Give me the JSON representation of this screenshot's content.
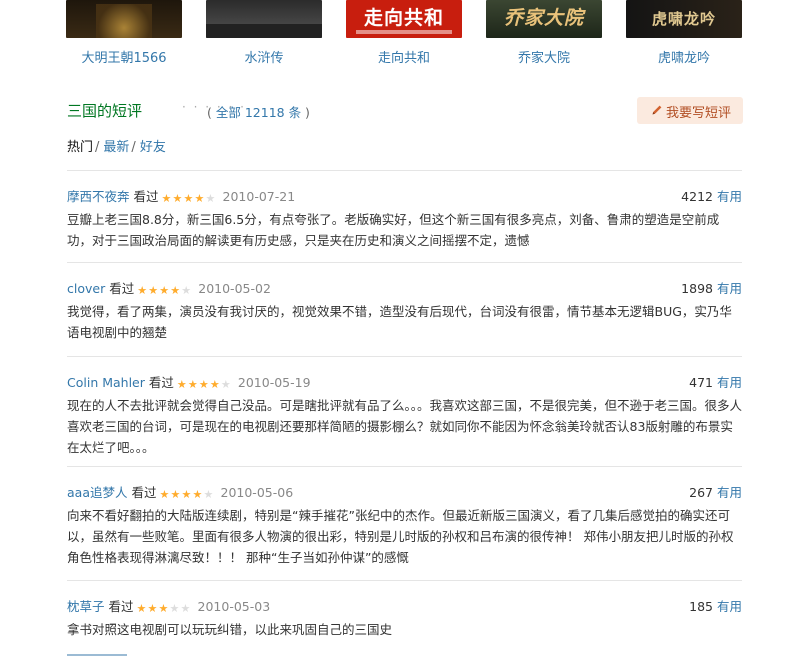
{
  "related_shows": [
    {
      "title": "大明王朝1566",
      "poster_text": "",
      "bg": "#2a2014",
      "fg": "#d9a84a"
    },
    {
      "title": "水浒传",
      "poster_text": "",
      "bg": "#3a3a3a",
      "fg": "#cccccc"
    },
    {
      "title": "走向共和",
      "poster_text": "走向共和",
      "bg": "#c81e0e",
      "fg": "#ffffff"
    },
    {
      "title": "乔家大院",
      "poster_text": "乔家大院",
      "bg": "#2c3a2a",
      "fg": "#e9c27a"
    },
    {
      "title": "虎啸龙吟",
      "poster_text": "虎啸龙吟",
      "bg": "#1a1a1a",
      "fg": "#e0c890"
    }
  ],
  "section": {
    "title": "三国的短评",
    "dots": "· · · · · ·",
    "count_open": "( ",
    "count_text": "全部 12118 条",
    "count_close": " )",
    "write_button": "我要写短评"
  },
  "tabs": {
    "hot": "热门",
    "sep": "/",
    "latest": "最新",
    "friends": "好友"
  },
  "comments": [
    {
      "user": "摩西不夜奔",
      "status": "看过",
      "rating": 4,
      "date": "2010-07-21",
      "votes": "4212",
      "useful": "有用",
      "text": "豆瓣上老三国8.8分，新三国6.5分，有点夸张了。老版确实好，但这个新三国有很多亮点，刘备、鲁肃的塑造是空前成功，对于三国政治局面的解读更有历史感，只是夹在历史和演义之间摇摆不定，遗憾"
    },
    {
      "user": "clover",
      "status": "看过",
      "rating": 4,
      "date": "2010-05-02",
      "votes": "1898",
      "useful": "有用",
      "text": "我觉得，看了两集，演员没有我讨厌的，视觉效果不错，造型没有后现代，台词没有很雷，情节基本无逻辑BUG，实乃华语电视剧中的翘楚"
    },
    {
      "user": "Colin Mahler",
      "status": "看过",
      "rating": 4,
      "date": "2010-05-19",
      "votes": "471",
      "useful": "有用",
      "text": "现在的人不去批评就会觉得自己没品。可是瞎批评就有品了么。。。我喜欢这部三国，不是很完美，但不逊于老三国。很多人喜欢老三国的台词，可是现在的电视剧还要那样简陋的摄影棚么？就如同你不能因为怀念翁美玲就否认83版射雕的布景实在太烂了吧。。。"
    },
    {
      "user": "aaa追梦人",
      "status": "看过",
      "rating": 4,
      "date": "2010-05-06",
      "votes": "267",
      "useful": "有用",
      "text": "向来不看好翻拍的大陆版连续剧，特别是“辣手摧花”张纪中的杰作。但最近新版三国演义，看了几集后感觉拍的确实还可以，虽然有一些败笔。里面有很多人物演的很出彩，特别是儿时版的孙权和吕布演的很传神！ 郑伟小朋友把儿时版的孙权角色性格表现得淋漓尽致！！！ 那种“生子当如孙仲谋”的感慨"
    },
    {
      "user": "枕草子",
      "status": "看过",
      "rating": 3,
      "date": "2010-05-03",
      "votes": "185",
      "useful": "有用",
      "text": "拿书对照这电视剧可以玩玩纠错，以此来巩固自己的三国史"
    }
  ],
  "colors": {
    "link": "#3377aa",
    "section_title": "#007722",
    "star_on": "#ffac2d",
    "star_off": "#dddddd",
    "write_btn_bg": "#fbeadf",
    "write_btn_fg": "#b24e23"
  }
}
